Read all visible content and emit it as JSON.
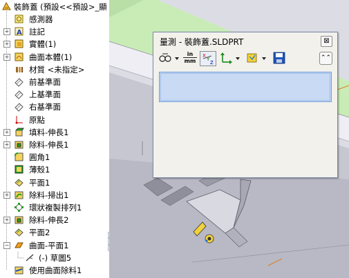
{
  "tree": {
    "root": "裝飾蓋 (預設<<預設>_顯",
    "items": [
      {
        "label": "感測器",
        "icon": "sensor-icon",
        "expand": false
      },
      {
        "label": "註記",
        "icon": "annotation-icon",
        "expand": true
      },
      {
        "label": "實體(1)",
        "icon": "solid-bodies-icon",
        "expand": true
      },
      {
        "label": "曲面本體(1)",
        "icon": "surface-bodies-icon",
        "expand": true
      },
      {
        "label": "材質 <未指定>",
        "icon": "material-icon",
        "expand": false
      },
      {
        "label": "前基準面",
        "icon": "plane-icon",
        "expand": false
      },
      {
        "label": "上基準面",
        "icon": "plane-icon",
        "expand": false
      },
      {
        "label": "右基準面",
        "icon": "plane-icon",
        "expand": false
      },
      {
        "label": "原點",
        "icon": "origin-icon",
        "expand": false
      },
      {
        "label": "填料-伸長1",
        "icon": "boss-extrude-icon",
        "expand": true
      },
      {
        "label": "除料-伸長1",
        "icon": "cut-extrude-icon",
        "expand": true
      },
      {
        "label": "圓角1",
        "icon": "fillet-icon",
        "expand": false
      },
      {
        "label": "薄殼1",
        "icon": "shell-icon",
        "expand": false
      },
      {
        "label": "平面1",
        "icon": "plane-feature-icon",
        "expand": false
      },
      {
        "label": "除料-掃出1",
        "icon": "cut-sweep-icon",
        "expand": true
      },
      {
        "label": "環狀複製排列1",
        "icon": "circular-pattern-icon",
        "expand": false
      },
      {
        "label": "除料-伸長2",
        "icon": "cut-extrude-icon",
        "expand": true
      },
      {
        "label": "平面2",
        "icon": "plane-feature-icon",
        "expand": false
      },
      {
        "label": "曲面-平面1",
        "icon": "surface-planar-icon",
        "expand": true,
        "expanded": true
      },
      {
        "label": "(-) 草圖5",
        "icon": "sketch-icon",
        "expand": false,
        "child": true
      },
      {
        "label": "使用曲面除料1",
        "icon": "surface-cut-icon",
        "expand": false
      }
    ]
  },
  "dialog": {
    "title": "量測 - 裝飾蓋.SLDPRT",
    "units_top": "in",
    "units_bottom": "mm",
    "close_glyph": "⊠",
    "collapse_glyph": "⌃⌃"
  },
  "colors": {
    "result_bg": "#c9daf4",
    "viewport_green": "#c9ecb7",
    "accent_orange": "#e07b1c"
  }
}
